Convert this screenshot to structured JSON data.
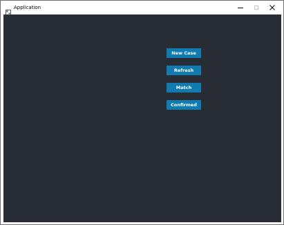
{
  "window": {
    "title": "Application",
    "app_icon": "application-icon",
    "controls": {
      "minimize_icon": "minimize-icon",
      "maximize_icon": "maximize-icon",
      "close_icon": "close-icon"
    }
  },
  "colors": {
    "client_background": "#272c35",
    "button_background": "#0f7bb1",
    "button_text": "#ffffff",
    "titlebar_background": "#ffffff"
  },
  "buttons": [
    {
      "label": "New Case"
    },
    {
      "label": "Refresh"
    },
    {
      "label": "Match"
    },
    {
      "label": "Confirmed"
    }
  ]
}
